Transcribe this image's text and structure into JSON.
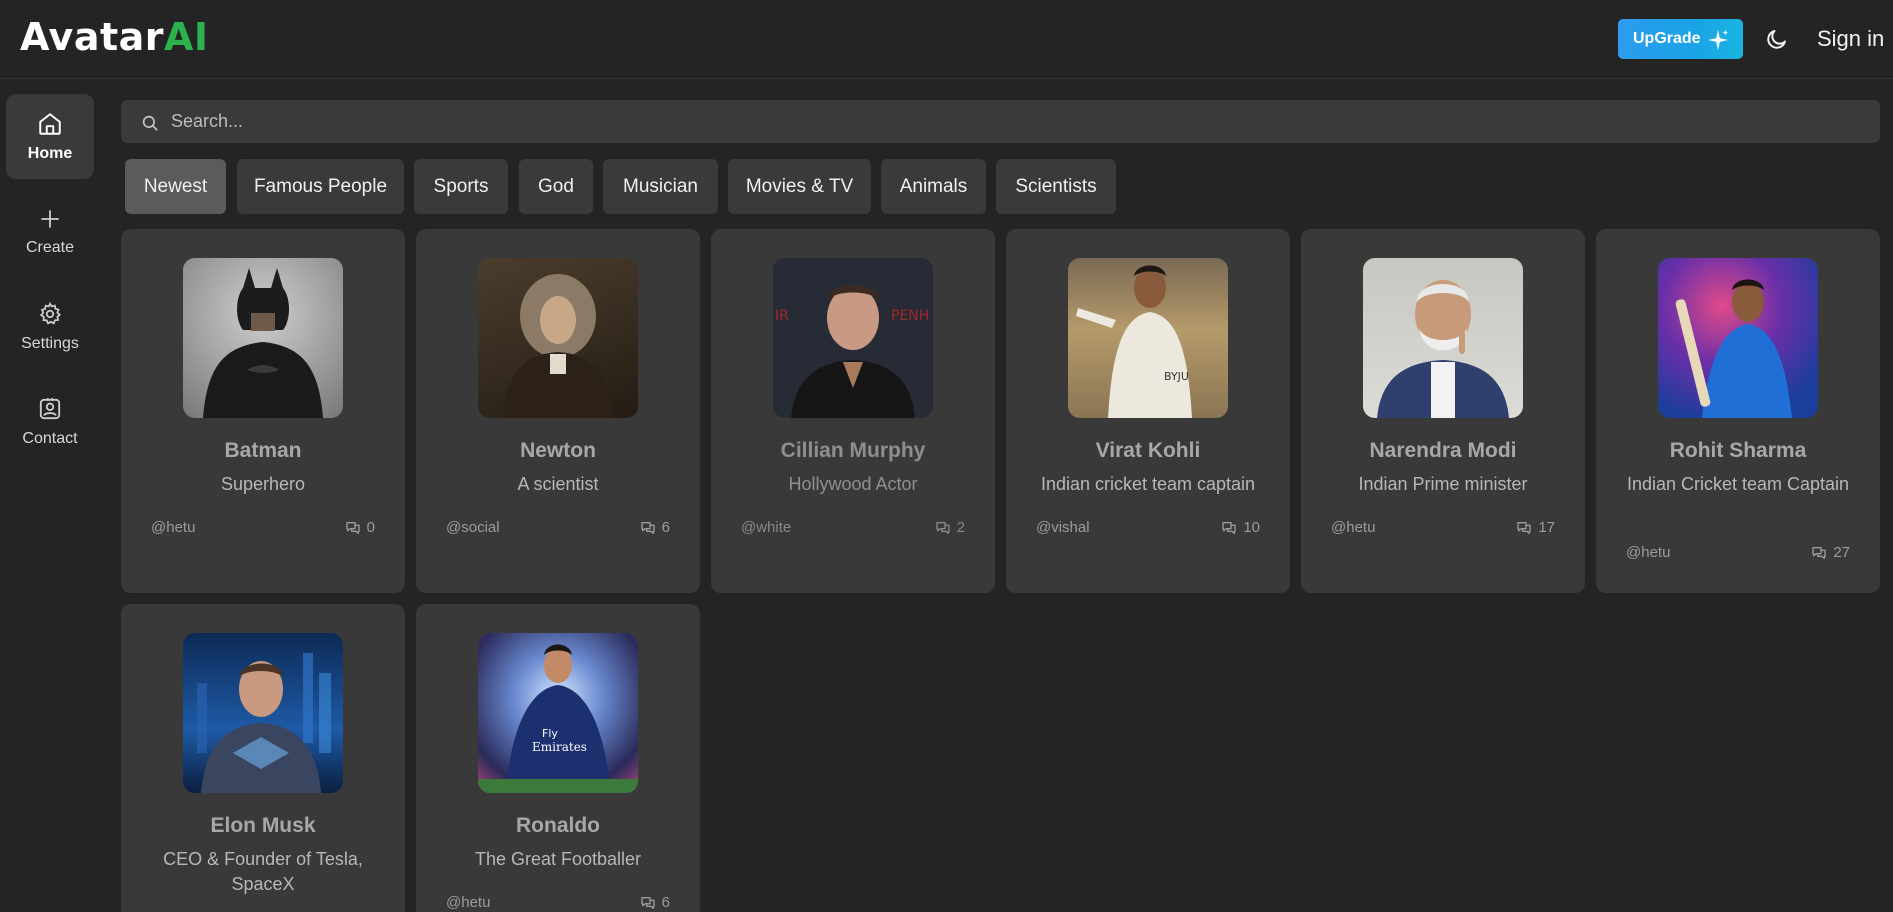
{
  "header": {
    "logo_main": "Avatar",
    "logo_accent": "AI",
    "upgrade_label": "UpGrade",
    "signin_label": "Sign in",
    "accent_color": "#2bb24c"
  },
  "sidebar": {
    "items": [
      {
        "label": "Home",
        "icon": "home-icon"
      },
      {
        "label": "Create",
        "icon": "plus-icon"
      },
      {
        "label": "Settings",
        "icon": "gear-icon"
      },
      {
        "label": "Contact",
        "icon": "contact-icon"
      }
    ]
  },
  "search": {
    "placeholder": "Search..."
  },
  "categories": [
    "Newest",
    "Famous People",
    "Sports",
    "God",
    "Musician",
    "Movies & TV",
    "Animals",
    "Scientists"
  ],
  "cards": [
    {
      "name": "Batman",
      "desc": "Superhero",
      "user": "@hetu",
      "count": "0"
    },
    {
      "name": "Newton",
      "desc": "A scientist",
      "user": "@social",
      "count": "6"
    },
    {
      "name": "Cillian Murphy",
      "desc": "Hollywood Actor",
      "user": "@white",
      "count": "2"
    },
    {
      "name": "Virat Kohli",
      "desc": "Indian cricket team captain",
      "user": "@vishal",
      "count": "10"
    },
    {
      "name": "Narendra Modi",
      "desc": "Indian Prime minister",
      "user": "@hetu",
      "count": "17"
    },
    {
      "name": "Rohit Sharma",
      "desc": "Indian Cricket team Captain",
      "user": "@hetu",
      "count": "27"
    },
    {
      "name": "Elon Musk",
      "desc": "CEO & Founder of Tesla, SpaceX",
      "user": "",
      "count": ""
    },
    {
      "name": "Ronaldo",
      "desc": "The Great Footballer",
      "user": "@hetu",
      "count": "6"
    }
  ]
}
